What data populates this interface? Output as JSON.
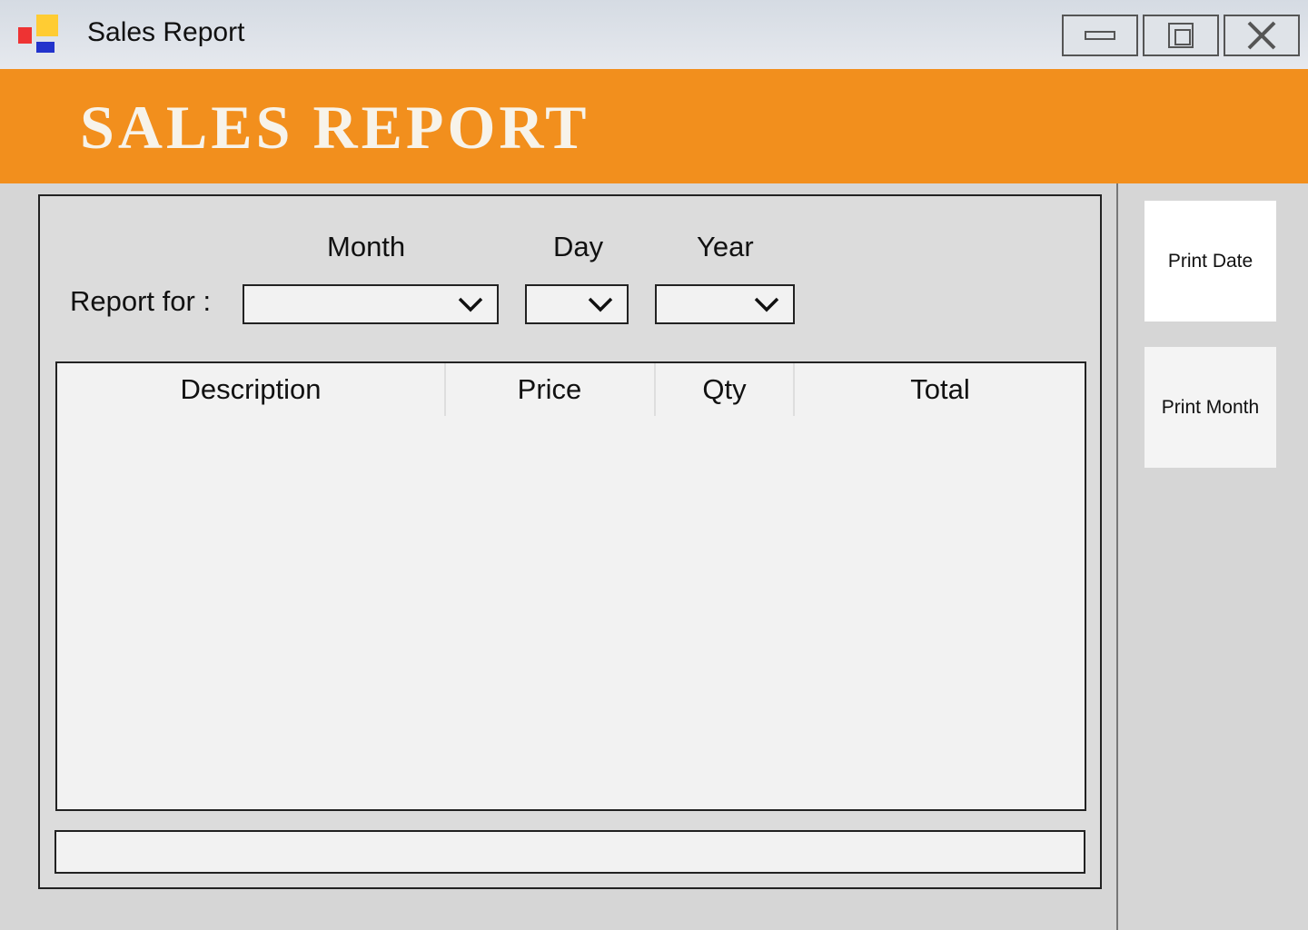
{
  "window": {
    "title": "Sales Report",
    "controls": {
      "minimize": "minimize",
      "maximize": "maximize",
      "close": "close"
    }
  },
  "banner": {
    "title": "SALES REPORT",
    "color": "#f28f1d"
  },
  "filters": {
    "report_label": "Report for :",
    "month_label": "Month",
    "day_label": "Day",
    "year_label": "Year",
    "month_value": "",
    "day_value": "",
    "year_value": ""
  },
  "table": {
    "columns": [
      "Description",
      "Price",
      "Qty",
      "Total"
    ],
    "rows": []
  },
  "total_field": {
    "value": ""
  },
  "actions": {
    "print_date": "Print Date",
    "print_month": "Print Month"
  }
}
